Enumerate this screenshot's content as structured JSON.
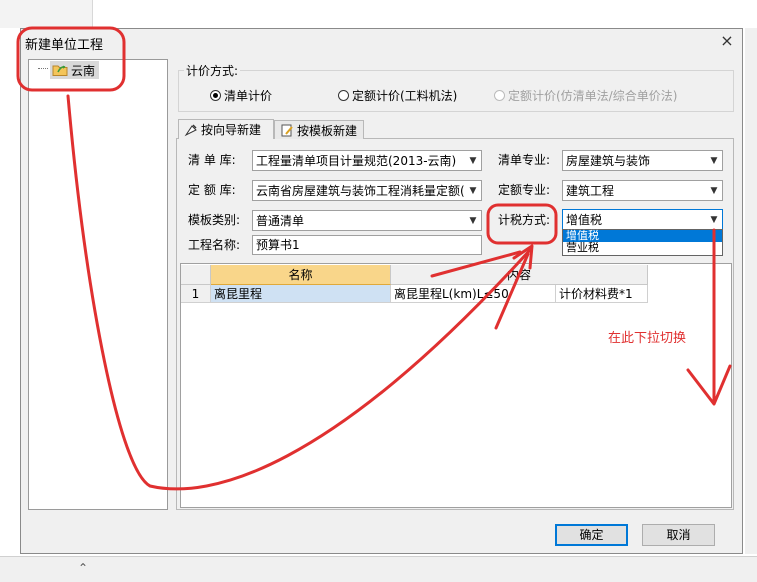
{
  "dialog": {
    "title": "新建单位工程",
    "close_label": "×",
    "tree": {
      "items": [
        {
          "label": "云南"
        }
      ]
    },
    "pricing_method": {
      "legend": "计价方式:",
      "options": [
        {
          "label": "清单计价",
          "selected": true,
          "disabled": false
        },
        {
          "label": "定额计价(工料机法)",
          "selected": false,
          "disabled": false
        },
        {
          "label": "定额计价(仿清单法/综合单价法)",
          "selected": false,
          "disabled": true
        }
      ]
    },
    "tabs": [
      {
        "label": "按向导新建",
        "active": true
      },
      {
        "label": "按模板新建",
        "active": false
      }
    ],
    "form": {
      "list_lib_label": "清 单 库:",
      "list_lib_value": "工程量清单项目计量规范(2013-云南)",
      "list_major_label": "清单专业:",
      "list_major_value": "房屋建筑与装饰",
      "quota_lib_label": "定 额 库:",
      "quota_lib_value": "云南省房屋建筑与装饰工程消耗量定额(",
      "quota_major_label": "定额专业:",
      "quota_major_value": "建筑工程",
      "template_label": "模板类别:",
      "template_value": "普通清单",
      "tax_label": "计税方式:",
      "tax_value": "增值税",
      "tax_options": [
        "增值税",
        "营业税"
      ],
      "project_name_label": "工程名称:",
      "project_name_value": "预算书1"
    },
    "grid": {
      "columns": [
        "名称",
        "内容"
      ],
      "rows": [
        {
          "num": "1",
          "name": "离昆里程",
          "content": "离昆里程L(km)L≤50",
          "extra": "计价材料费*1"
        }
      ]
    },
    "buttons": {
      "ok": "确定",
      "cancel": "取消"
    }
  },
  "annotation": {
    "text": "在此下拉切换",
    "color": "#e03030"
  },
  "scroll_up_label": "⌃"
}
